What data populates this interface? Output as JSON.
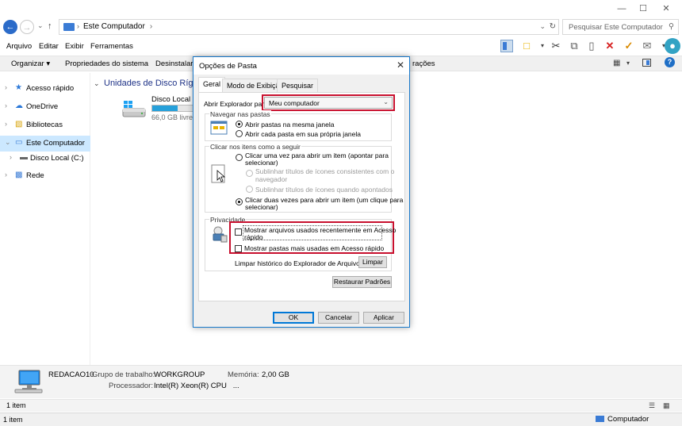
{
  "window": {
    "breadcrumb": "Este Computador",
    "search_placeholder": "Pesquisar Este Computador"
  },
  "menu": [
    "Arquivo",
    "Editar",
    "Exibir",
    "Ferramentas"
  ],
  "commands": [
    "Organizar ▾",
    "Propriedades do sistema",
    "Desinstalar",
    "rações"
  ],
  "nav": [
    {
      "label": "Acesso rápido",
      "icon": "star-icon"
    },
    {
      "label": "OneDrive",
      "icon": "cloud-icon"
    },
    {
      "label": "Bibliotecas",
      "icon": "library-icon"
    },
    {
      "label": "Este Computador",
      "icon": "computer-icon"
    },
    {
      "label": "Disco Local (C:)",
      "icon": "drive-icon"
    },
    {
      "label": "Rede",
      "icon": "network-icon"
    }
  ],
  "content": {
    "group_header": "Unidades de Disco Rígi",
    "disk_name": "Disco Local (C",
    "disk_free": "66,0 GB livre",
    "disk_used_fraction": 0.55
  },
  "details": {
    "computer_name": "REDACAO10",
    "workgroup_label": "Grupo de trabalho:",
    "workgroup_value": "WORKGROUP",
    "memory_label": "Memória:",
    "memory_value": "2,00 GB",
    "processor_label": "Processador:",
    "processor_value": "Intel(R) Xeon(R) CPU   ..."
  },
  "status": {
    "item_count_1": "1 item",
    "item_count_2": "1 item",
    "location": "Computador"
  },
  "dialog": {
    "title": "Opções de Pasta",
    "tabs": [
      "Geral",
      "Modo de Exibição",
      "Pesquisar"
    ],
    "open_explorer_label": "Abrir Explorador para",
    "open_explorer_value": "Meu computador",
    "browse_group": "Navegar nas pastas",
    "browse_same": "Abrir pastas na mesma janela",
    "browse_own": "Abrir cada pasta em sua própria janela",
    "click_group": "Clicar nos itens como a seguir",
    "single_click_1": "Clicar uma vez para abrir um item (apontar para",
    "single_click_2": "selecionar)",
    "underline_consistent_1": "Sublinhar títulos de ícones consistentes com o",
    "underline_consistent_2": "navegador",
    "underline_point": "Sublinhar títulos de ícones quando apontados",
    "double_click_1": "Clicar duas vezes para abrir um item (um clique para",
    "double_click_2": "selecionar)",
    "privacy_group": "Privacidade",
    "show_recent_1": "Mostrar arquivos usados recentemente em Acesso",
    "show_recent_2": "rápido",
    "show_frequent": "Mostrar pastas mais usadas em Acesso rápido",
    "clear_history_label": "Limpar histórico do Explorador de Arquivos",
    "clear_button": "Limpar",
    "restore_button": "Restaurar Padrões",
    "ok_button": "OK",
    "cancel_button": "Cancelar",
    "apply_button": "Aplicar"
  }
}
